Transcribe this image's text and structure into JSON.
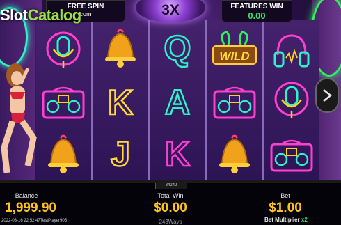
{
  "branding": {
    "logo_part1": "Slot",
    "logo_part2": "Catalog"
  },
  "top": {
    "free_spin_label": "FREE SPIN",
    "free_spin_sub": "com",
    "multiplier": "3X",
    "features_win_label": "FEATURES WIN",
    "features_win_value": "0.00"
  },
  "reels": {
    "columns": [
      [
        "microphone-icon",
        "boombox-icon",
        "bell-icon"
      ],
      [
        "bell-icon",
        "K",
        "J"
      ],
      [
        "Q",
        "A",
        "K"
      ],
      [
        "wild-icon",
        "boombox-icon",
        "bell-icon"
      ],
      [
        "headphones-icon",
        "microphone-icon",
        "boombox-icon"
      ]
    ],
    "wild_text": "WILD",
    "letters": {
      "K": "K",
      "J": "J",
      "Q": "Q",
      "A": "A"
    }
  },
  "hud": {
    "balance_label": "Balance",
    "balance_value": "1,999.90",
    "total_win_label": "Total Win",
    "total_win_value": "$0.00",
    "bet_label": "Bet",
    "bet_value": "$1.00",
    "ways": "243Ways",
    "bet_multiplier_label": "Bet Multiplier",
    "bet_multiplier_value": "x2",
    "transaction_id": "84242",
    "timestamp": "2022-03-16 22:52:47",
    "player": "TestPlayer905"
  },
  "colors": {
    "accent_gold": "#ffc21a",
    "accent_green": "#39e26a",
    "neon_pink": "#ff3fd0",
    "neon_cyan": "#2ef2c8"
  }
}
